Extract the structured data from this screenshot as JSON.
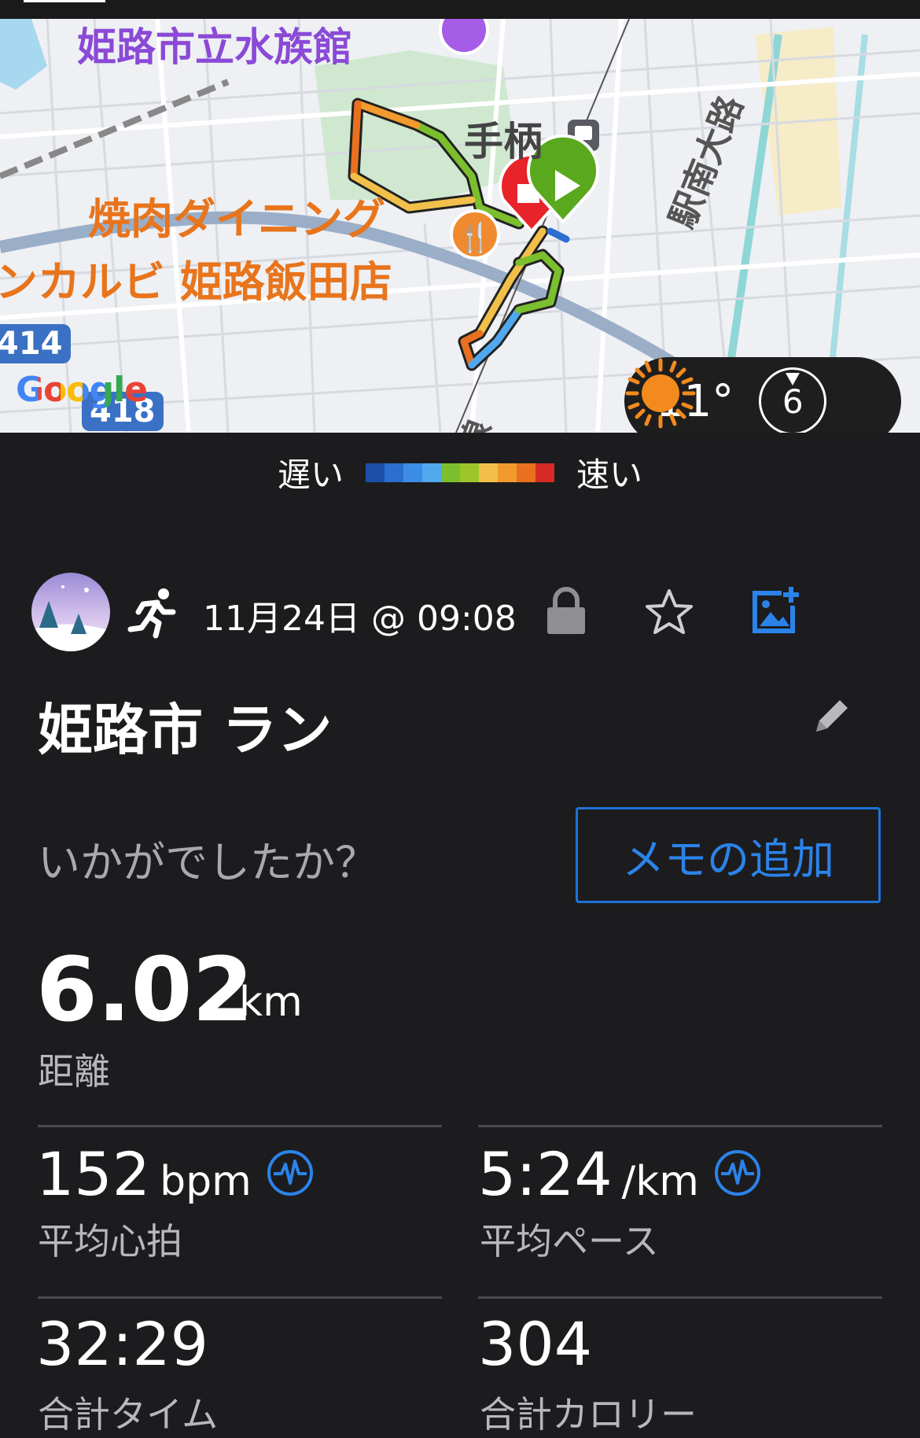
{
  "map": {
    "labels": {
      "aquarium": "姫路市立水族館",
      "station": "手柄",
      "restaurant_line1": "焼肉ダイニング",
      "restaurant_line2": "ンカルビ 姫路飯田店",
      "road": "駅南大路",
      "rail_line": "線",
      "route_414": "414",
      "route_418": "418",
      "attribution": "Google"
    },
    "weather": {
      "temperature": "11°",
      "condition_icon": "sun-icon",
      "wind_speed": "6"
    },
    "colors": {
      "route_fast": "#d62a24",
      "route_slow": "#1a56b0",
      "start_marker": "#5aa81e",
      "end_marker": "#e8232a"
    }
  },
  "legend": {
    "slow_label": "遅い",
    "fast_label": "速い",
    "scale_colors": [
      "#1d4fa8",
      "#2a6fcf",
      "#3d8de6",
      "#51a8ee",
      "#7bbf2e",
      "#9cc72a",
      "#f2c04a",
      "#f29a2e",
      "#e8701f",
      "#d62a24"
    ]
  },
  "activity": {
    "type_icon": "running-icon",
    "datetime": "11月24日 @ 09:08",
    "title": "姫路市 ラン",
    "prompt": "いかがでしたか？",
    "add_memo_label": "メモの追加"
  },
  "stats": {
    "distance": {
      "value": "6.02",
      "unit": "km",
      "label": "距離"
    },
    "avg_hr": {
      "value": "152",
      "unit": "bpm",
      "label": "平均心拍"
    },
    "avg_pace": {
      "value": "5:24",
      "unit": "/km",
      "label": "平均ペース"
    },
    "total_time": {
      "value": "32:29",
      "label": "合計タイム"
    },
    "total_calories": {
      "value": "304",
      "label": "合計カロリー"
    }
  },
  "accent_color": "#2b83ea"
}
